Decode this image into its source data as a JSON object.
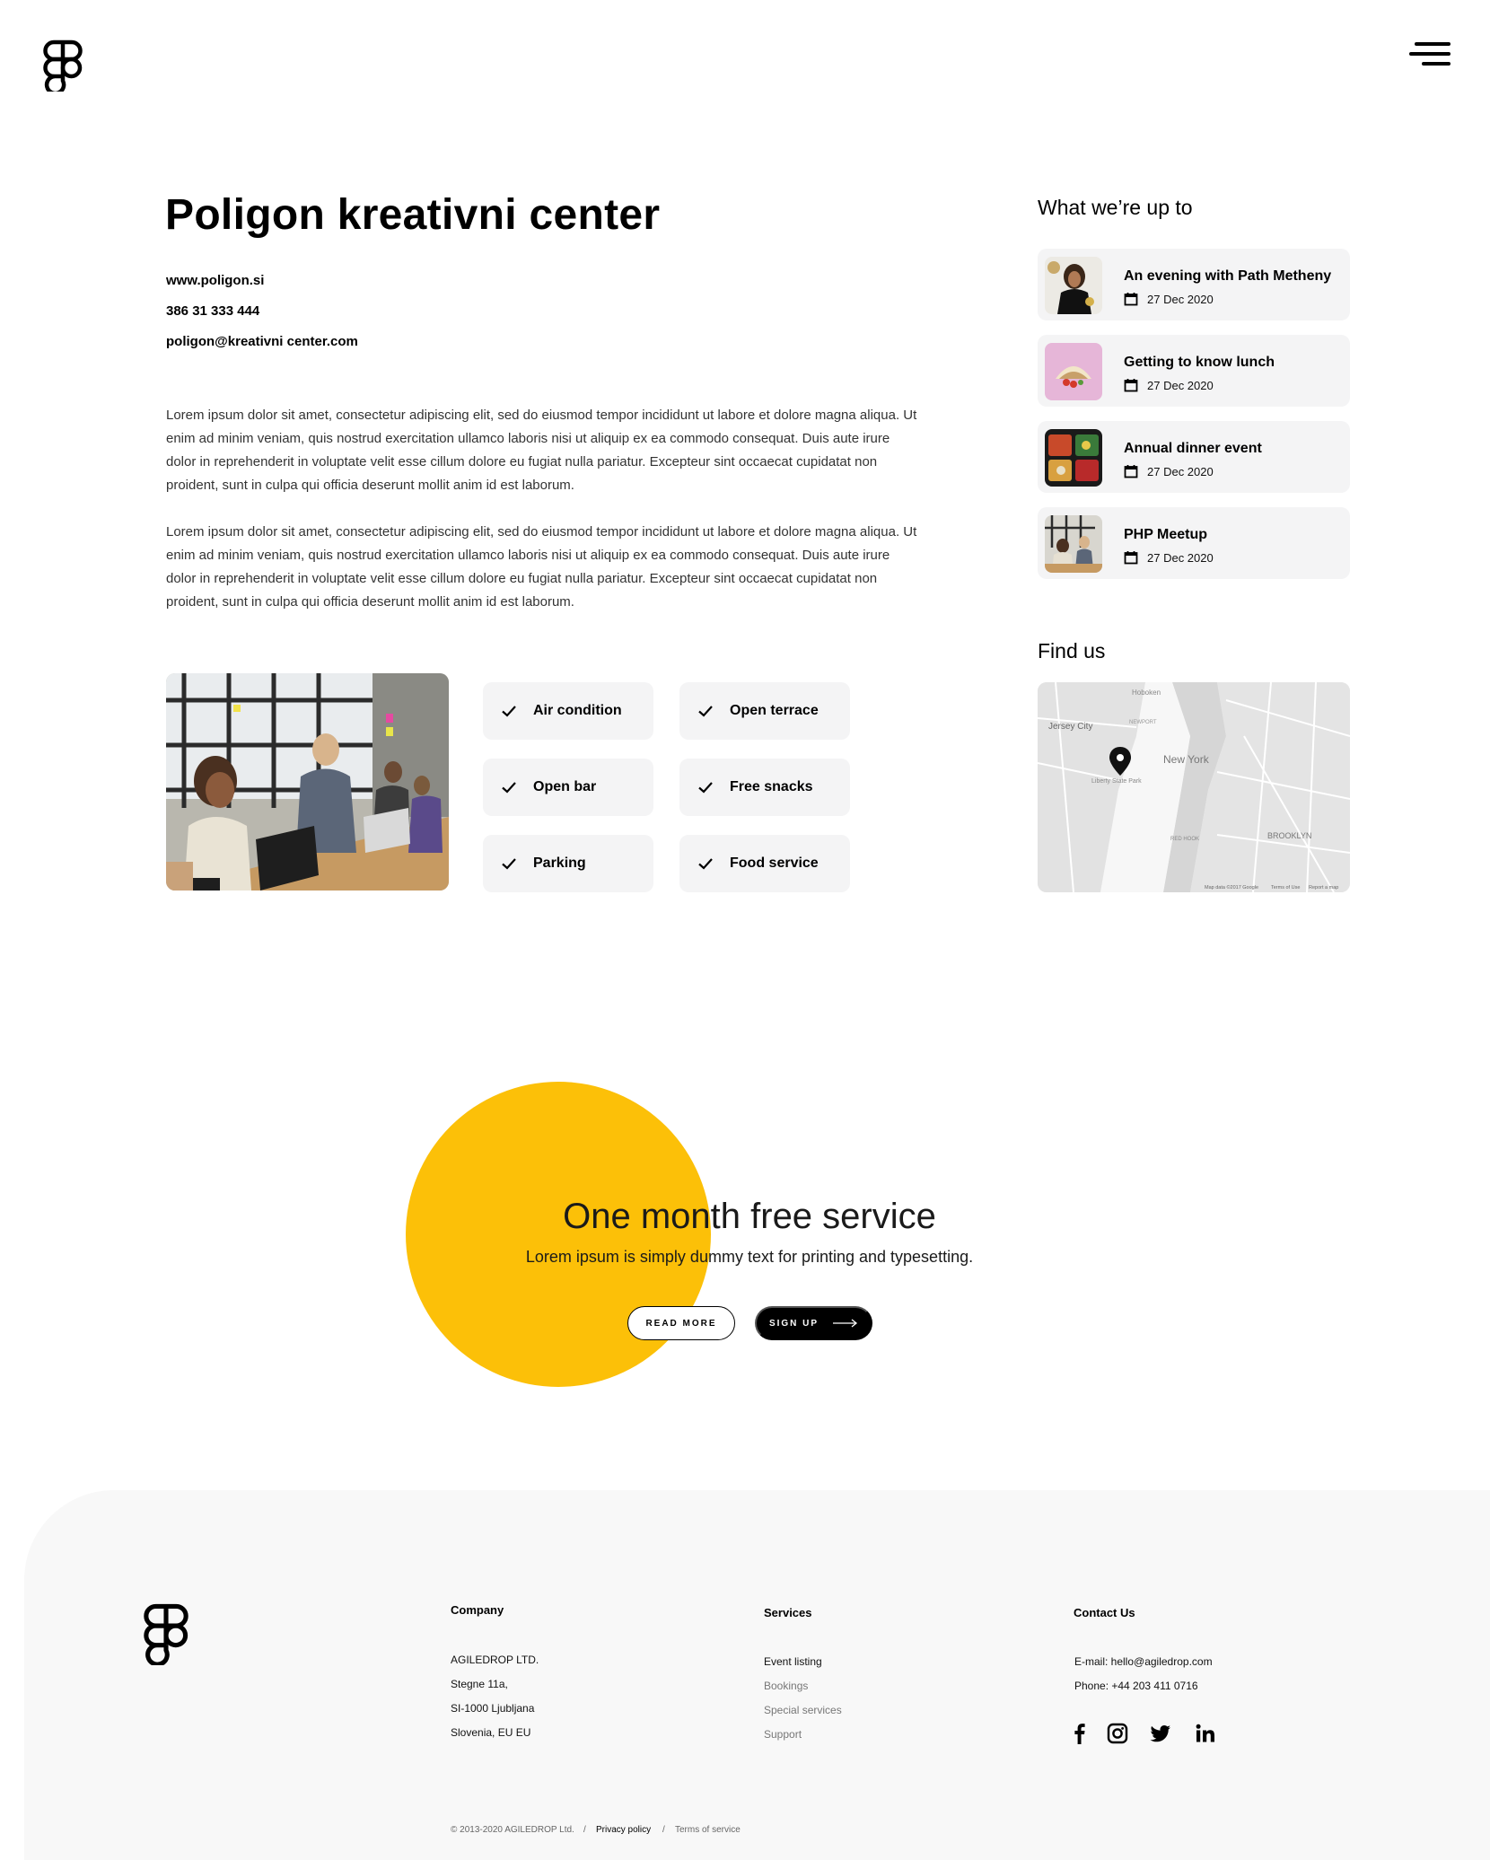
{
  "header": {
    "logo_icon": "figma-logo-icon",
    "menu_icon": "hamburger-menu-icon"
  },
  "venue": {
    "title": "Poligon kreativni center",
    "website": "www.poligon.si",
    "phone": "386 31 333 444",
    "email": "poligon@kreativni center.com",
    "paragraphs": [
      "Lorem ipsum dolor sit amet, consectetur adipiscing elit, sed do eiusmod tempor incididunt ut labore et dolore magna aliqua. Ut enim ad minim veniam, quis nostrud exercitation ullamco laboris nisi ut aliquip ex ea commodo consequat. Duis aute irure dolor in reprehenderit in voluptate velit esse cillum dolore eu fugiat nulla pariatur. Excepteur sint occaecat cupidatat non proident, sunt in culpa qui officia deserunt mollit anim id est laborum.",
      "Lorem ipsum dolor sit amet, consectetur adipiscing elit, sed do eiusmod tempor incididunt ut labore et dolore magna aliqua. Ut enim ad minim veniam, quis nostrud exercitation ullamco laboris nisi ut aliquip ex ea commodo consequat. Duis aute irure dolor in reprehenderit in voluptate velit esse cillum dolore eu fugiat nulla pariatur. Excepteur sint occaecat cupidatat non proident, sunt in culpa qui officia deserunt mollit anim id est laborum."
    ],
    "amenities": [
      "Air condition",
      "Open terrace",
      "Open bar",
      "Free snacks",
      "Parking",
      "Food service"
    ],
    "check_icon": "checkmark-icon"
  },
  "sidebar": {
    "events_heading": "What we’re up to",
    "events": [
      {
        "title": "An evening with Path Metheny",
        "date": "27 Dec 2020"
      },
      {
        "title": "Getting to know lunch",
        "date": "27 Dec 2020"
      },
      {
        "title": "Annual dinner event",
        "date": "27 Dec 2020"
      },
      {
        "title": "PHP Meetup",
        "date": "27 Dec 2020"
      }
    ],
    "calendar_icon": "calendar-icon",
    "map_heading": "Find us",
    "map_pin_icon": "map-pin-icon",
    "map_labels": {
      "hoboken": "Hoboken",
      "jersey_city": "Jersey City",
      "new_york": "New York",
      "liberty": "Liberty State Park",
      "brooklyn": "BROOKLYN",
      "red_hook": "RED HOOK",
      "newport": "NEWPORT",
      "attribution": "Map data ©2017 Google",
      "terms": "Terms of Use",
      "report": "Report a map"
    }
  },
  "promo": {
    "title": "One month free service",
    "subtitle": "Lorem ipsum is simply dummy text for printing and typesetting.",
    "read_more": "READ MORE",
    "sign_up": "SIGN UP",
    "accent_color": "#fcc008"
  },
  "footer": {
    "company": {
      "heading": "Company",
      "lines": [
        "AGILEDROP LTD.",
        "Stegne 11a,",
        "SI-1000 Ljubljana",
        "Slovenia, EU EU"
      ]
    },
    "services": {
      "heading": "Services",
      "items": [
        "Event listing",
        "Bookings",
        "Special services",
        "Support"
      ]
    },
    "contact": {
      "heading": "Contact Us",
      "email": "E-mail: hello@agiledrop.com",
      "phone": "Phone: +44 203 411 0716"
    },
    "social_icons": [
      "facebook-icon",
      "instagram-icon",
      "twitter-icon",
      "linkedin-icon"
    ],
    "copyright": "© 2013-2020 AGILEDROP Ltd.",
    "sep": "/",
    "privacy": "Privacy policy",
    "terms": "Terms of service"
  }
}
